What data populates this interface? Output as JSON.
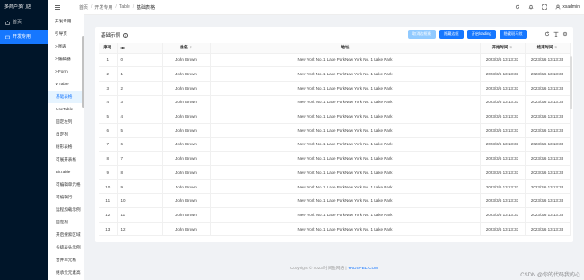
{
  "app": {
    "brand": "多商户多门店"
  },
  "primary_nav": [
    {
      "label": "首页",
      "icon": "home-icon",
      "active": false
    },
    {
      "label": "开发专用",
      "icon": "dev-icon",
      "active": true
    }
  ],
  "secondary_nav": {
    "items": [
      {
        "label": "开发专用",
        "type": "top"
      },
      {
        "label": "引导页",
        "type": "item"
      },
      {
        "label": "> 图表",
        "type": "group"
      },
      {
        "label": "> 编辑器",
        "type": "group"
      },
      {
        "label": "> Form",
        "type": "group"
      },
      {
        "label": "∨ Table",
        "type": "group"
      },
      {
        "label": "基础表格",
        "type": "sub",
        "active": true
      },
      {
        "label": "UseTable",
        "type": "sub"
      },
      {
        "label": "固定左列",
        "type": "sub"
      },
      {
        "label": "自定列",
        "type": "sub"
      },
      {
        "label": "树形表格",
        "type": "sub"
      },
      {
        "label": "可展开表格",
        "type": "sub"
      },
      {
        "label": "BitTable",
        "type": "sub"
      },
      {
        "label": "可编辑单元格",
        "type": "sub"
      },
      {
        "label": "可编辑行",
        "type": "sub"
      },
      {
        "label": "远程加载示例",
        "type": "sub"
      },
      {
        "label": "固定列",
        "type": "sub"
      },
      {
        "label": "开启搜索区域",
        "type": "sub"
      },
      {
        "label": "多级表头示例",
        "type": "sub"
      },
      {
        "label": "合并单元格",
        "type": "sub"
      },
      {
        "label": "继承父元素高",
        "type": "sub"
      }
    ]
  },
  "breadcrumb": [
    "首页",
    "开发专用",
    "Table",
    "基础表格"
  ],
  "header": {
    "username": "xsadmin"
  },
  "card": {
    "title": "基础示例",
    "buttons": [
      "取消边框线",
      "隐藏边框",
      "开启loading",
      "隐藏斑马纹"
    ]
  },
  "table": {
    "columns": [
      "序号",
      "ID",
      "姓名",
      "地址",
      "开始时间",
      "结束时间"
    ],
    "rows": [
      [
        "1",
        "0",
        "John Brown",
        "New York No. 1 Lake ParkNew York No. 1 Lake Park",
        "2023/3/6 13:13:33",
        "2023/3/6 13:13:33"
      ],
      [
        "2",
        "1",
        "John Brown",
        "New York No. 1 Lake ParkNew York No. 1 Lake Park",
        "2023/3/6 13:13:33",
        "2023/3/6 13:13:33"
      ],
      [
        "3",
        "2",
        "John Brown",
        "New York No. 1 Lake ParkNew York No. 1 Lake Park",
        "2023/3/6 13:13:33",
        "2023/3/6 13:13:33"
      ],
      [
        "4",
        "3",
        "John Brown",
        "New York No. 1 Lake ParkNew York No. 1 Lake Park",
        "2023/3/6 13:13:33",
        "2023/3/6 13:13:33"
      ],
      [
        "5",
        "4",
        "John Brown",
        "New York No. 1 Lake ParkNew York No. 1 Lake Park",
        "2023/3/6 13:13:33",
        "2023/3/6 13:13:33"
      ],
      [
        "6",
        "5",
        "John Brown",
        "New York No. 1 Lake ParkNew York No. 1 Lake Park",
        "2023/3/6 13:13:33",
        "2023/3/6 13:13:33"
      ],
      [
        "7",
        "6",
        "John Brown",
        "New York No. 1 Lake ParkNew York No. 1 Lake Park",
        "2023/3/6 13:13:33",
        "2023/3/6 13:13:33"
      ],
      [
        "8",
        "7",
        "John Brown",
        "New York No. 1 Lake ParkNew York No. 1 Lake Park",
        "2023/3/6 13:13:33",
        "2023/3/6 13:13:33"
      ],
      [
        "9",
        "8",
        "John Brown",
        "New York No. 1 Lake ParkNew York No. 1 Lake Park",
        "2023/3/6 13:13:33",
        "2023/3/6 13:13:33"
      ],
      [
        "10",
        "9",
        "John Brown",
        "New York No. 1 Lake ParkNew York No. 1 Lake Park",
        "2023/3/6 13:13:33",
        "2023/3/6 13:13:33"
      ],
      [
        "11",
        "10",
        "John Brown",
        "New York No. 1 Lake ParkNew York No. 1 Lake Park",
        "2023/3/6 13:13:33",
        "2023/3/6 13:13:33"
      ],
      [
        "12",
        "11",
        "John Brown",
        "New York No. 1 Lake ParkNew York No. 1 Lake Park",
        "2023/3/6 13:13:33",
        "2023/3/6 13:13:33"
      ],
      [
        "13",
        "12",
        "John Brown",
        "New York No. 1 Lake ParkNew York No. 1 Lake Park",
        "2023/3/6 13:13:33",
        "2023/3/6 13:13:33"
      ]
    ]
  },
  "footer": {
    "text": "Copyright © 2023 时间鱼网络 | ",
    "link": "YRDSPBD.COM"
  },
  "watermark": "CSDN @你的代码我的心",
  "colors": {
    "primary": "#1677ff",
    "sidebar_dark": "#001529"
  }
}
